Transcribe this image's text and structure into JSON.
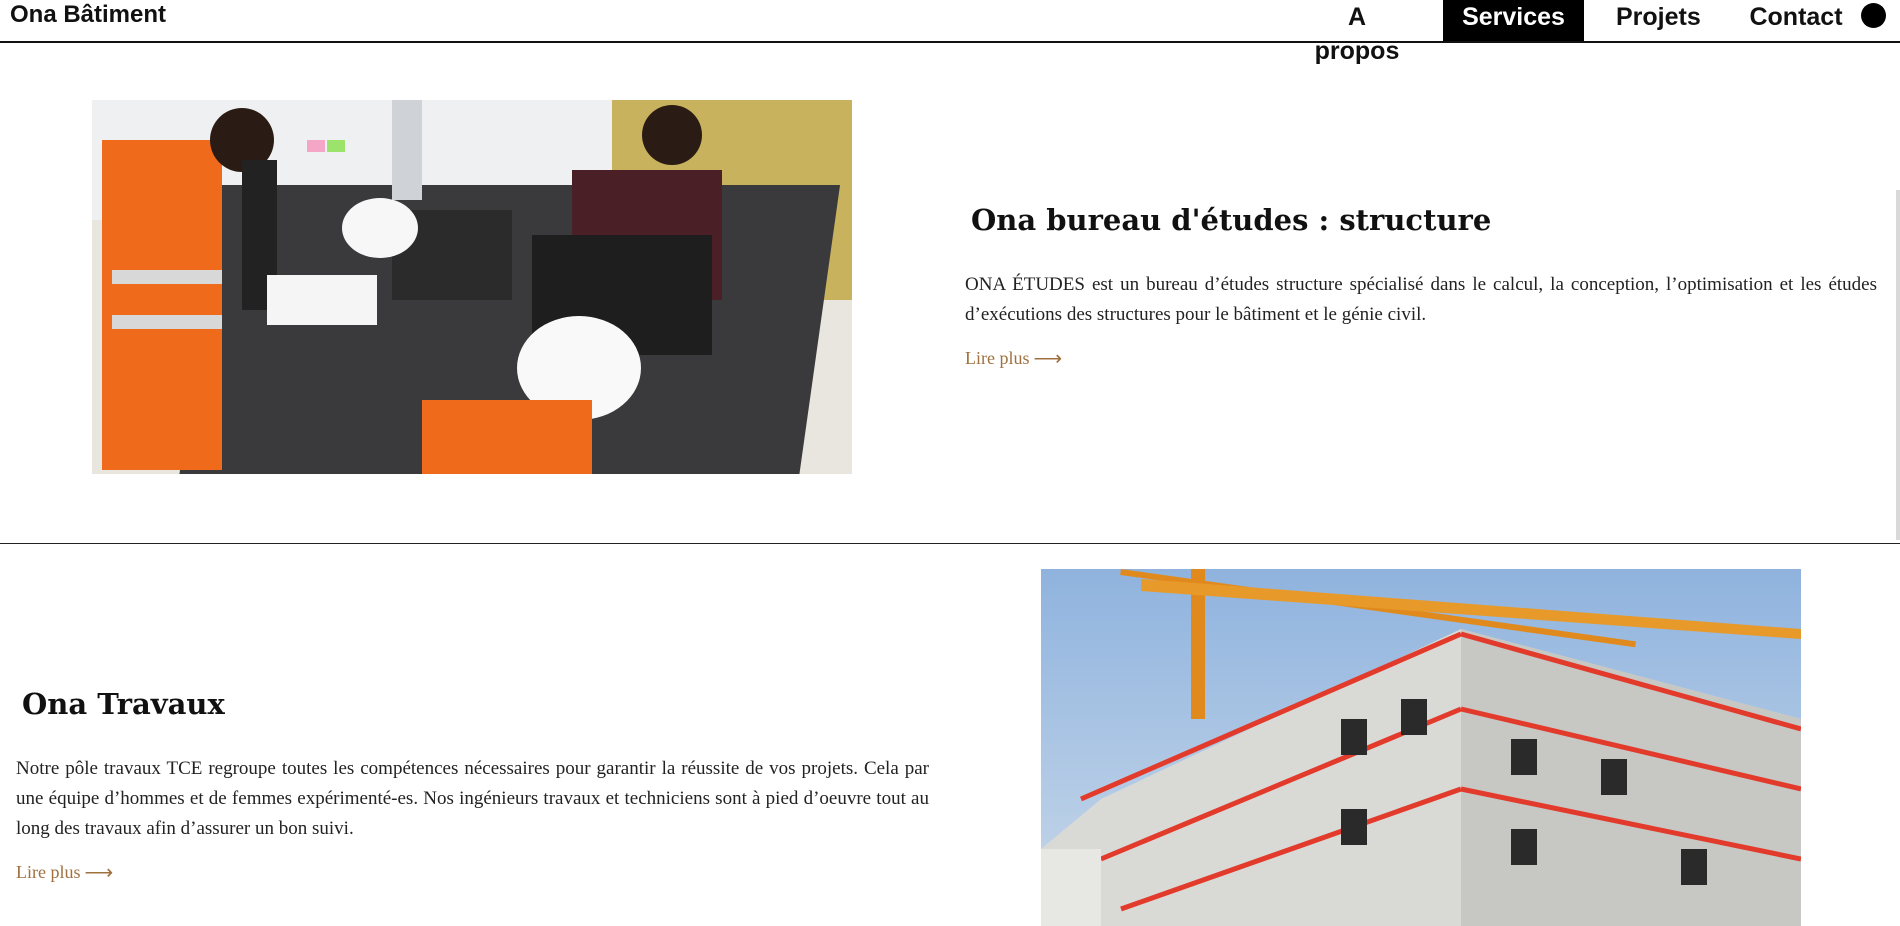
{
  "header": {
    "brand": "Ona Bâtiment",
    "nav": [
      {
        "label": "A propos",
        "active": false
      },
      {
        "label": "Services",
        "active": true
      },
      {
        "label": "Projets",
        "active": false
      },
      {
        "label": "Contact",
        "active": false
      }
    ],
    "menu_icon": "circle-dot-icon"
  },
  "services": [
    {
      "title": "Ona bureau d'études : structure",
      "description": "ONA ÉTUDES est un bureau d’études structure spécialisé dans le calcul, la conception, l’optimisation et les études d’exécutions des structures pour le bâtiment et le génie civil.",
      "link_label": "Lire plus",
      "link_icon": "arrow-right-icon",
      "image": "engineers-office-photo"
    },
    {
      "title": "Ona Travaux",
      "description": "Notre pôle travaux TCE regroupe toutes les compétences nécessaires pour garantir la réussite de vos projets. Cela par une équipe d’hommes et de femmes expérimenté-es. Nos ingénieurs travaux et techniciens sont à pied d’oeuvre tout au long des travaux afin d’assurer un bon suivi.",
      "link_label": "Lire plus",
      "link_icon": "arrow-right-icon",
      "image": "construction-site-photo"
    }
  ],
  "colors": {
    "link": "#a0703f",
    "nav_active_bg": "#000000",
    "text": "#111111"
  }
}
